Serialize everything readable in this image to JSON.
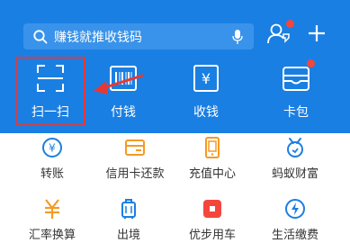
{
  "search": {
    "placeholder": "赚钱就推收钱码"
  },
  "header_actions": [
    {
      "icon": "contacts-icon"
    },
    {
      "icon": "plus-icon"
    }
  ],
  "top_actions": [
    {
      "label": "扫一扫",
      "icon": "scan-icon"
    },
    {
      "label": "付钱",
      "icon": "barcode-icon"
    },
    {
      "label": "收钱",
      "icon": "receive-money-icon"
    },
    {
      "label": "卡包",
      "icon": "card-wallet-icon"
    }
  ],
  "services": [
    {
      "label": "转账",
      "icon": "transfer-icon",
      "color": "#1a7fe3"
    },
    {
      "label": "信用卡还款",
      "icon": "credit-card-icon",
      "color": "#f59a23"
    },
    {
      "label": "充值中心",
      "icon": "phone-icon",
      "color": "#f59a23"
    },
    {
      "label": "蚂蚁财富",
      "icon": "ant-fortune-icon",
      "color": "#1a7fe3"
    },
    {
      "label": "汇率换算",
      "icon": "exchange-rate-icon",
      "color": "#f59a23"
    },
    {
      "label": "出境",
      "icon": "luggage-icon",
      "color": "#1a7fe3"
    },
    {
      "label": "优步用车",
      "icon": "uber-icon",
      "color": "#f5463c"
    },
    {
      "label": "生活缴费",
      "icon": "utility-bill-icon",
      "color": "#1a7fe3"
    }
  ],
  "colors": {
    "header": "#1a7fe3",
    "highlight": "#e53935",
    "badge": "#f5463c"
  }
}
